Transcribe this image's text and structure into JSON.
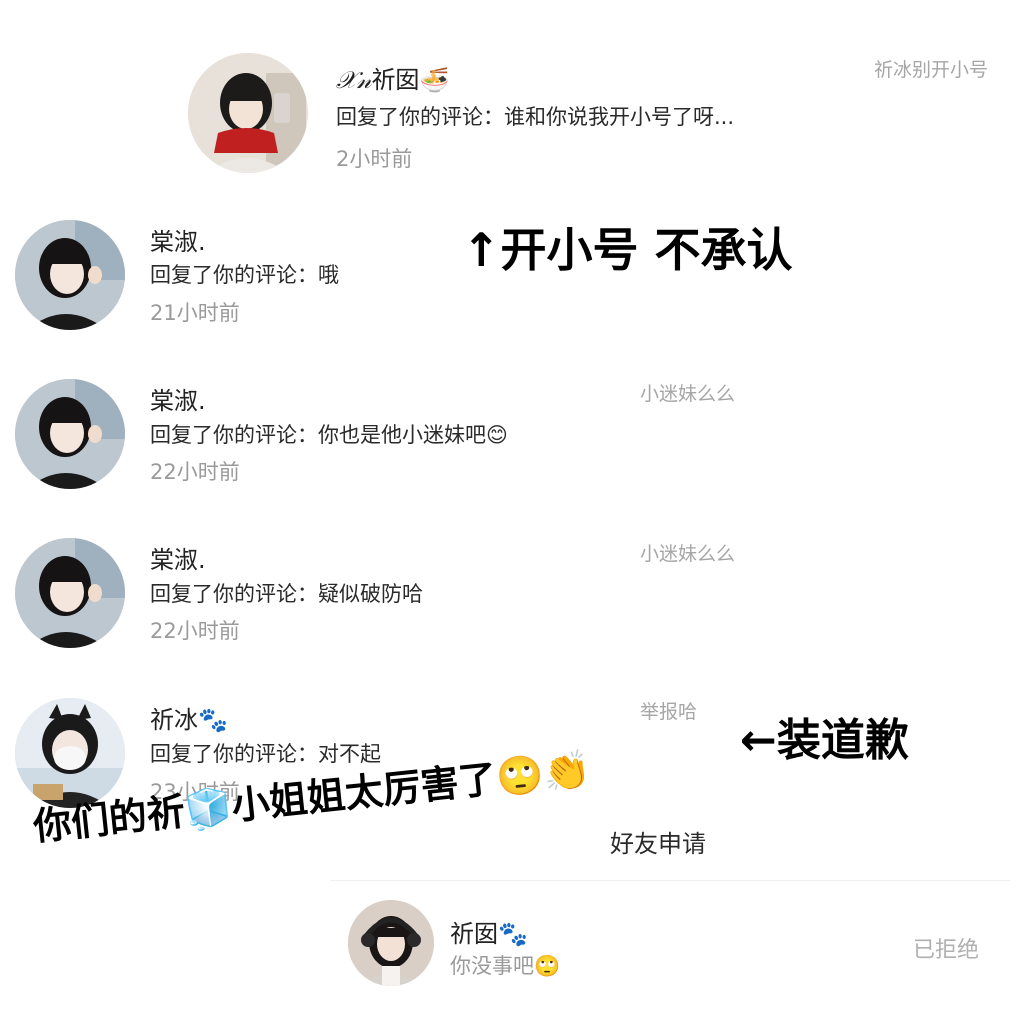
{
  "notifications": [
    {
      "name_prefix": "𝒳𝓃",
      "name": "祈囡",
      "name_emoji": "🍜",
      "message": "回复了你的评论：谁和你说我开小号了呀...",
      "time": "2小时前",
      "reference": "祈冰别开小号",
      "avatar_icon": "girl-red-scarf-avatar"
    },
    {
      "name": "棠淑.",
      "message": "回复了你的评论：哦",
      "time": "21小时前",
      "reference": "",
      "avatar_icon": "girl-black-hair-avatar"
    },
    {
      "name": "棠淑.",
      "message": "回复了你的评论：你也是他小迷妹吧😊",
      "time": "22小时前",
      "reference": "小迷妹么么",
      "avatar_icon": "girl-black-hair-avatar"
    },
    {
      "name": "棠淑.",
      "message": "回复了你的评论：疑似破防哈",
      "time": "22小时前",
      "reference": "小迷妹么么",
      "avatar_icon": "girl-black-hair-avatar"
    },
    {
      "name": "祈冰",
      "name_emoji": "🐾",
      "message": "回复了你的评论：对不起",
      "time": "23小时前",
      "reference": "举报哈",
      "avatar_icon": "girl-mask-cat-ears-avatar"
    }
  ],
  "annotations": {
    "top": "↑开小号 不承认",
    "apology": "←装道歉",
    "bottom_caption": "你们的祈🧊小姐姐太厉害了🙄👏"
  },
  "friend_request": {
    "section_label": "好友申请",
    "name": "祈囡",
    "name_emoji": "🐾",
    "message": "你没事吧🙄",
    "status": "已拒绝",
    "avatar_icon": "girl-headphones-avatar"
  }
}
